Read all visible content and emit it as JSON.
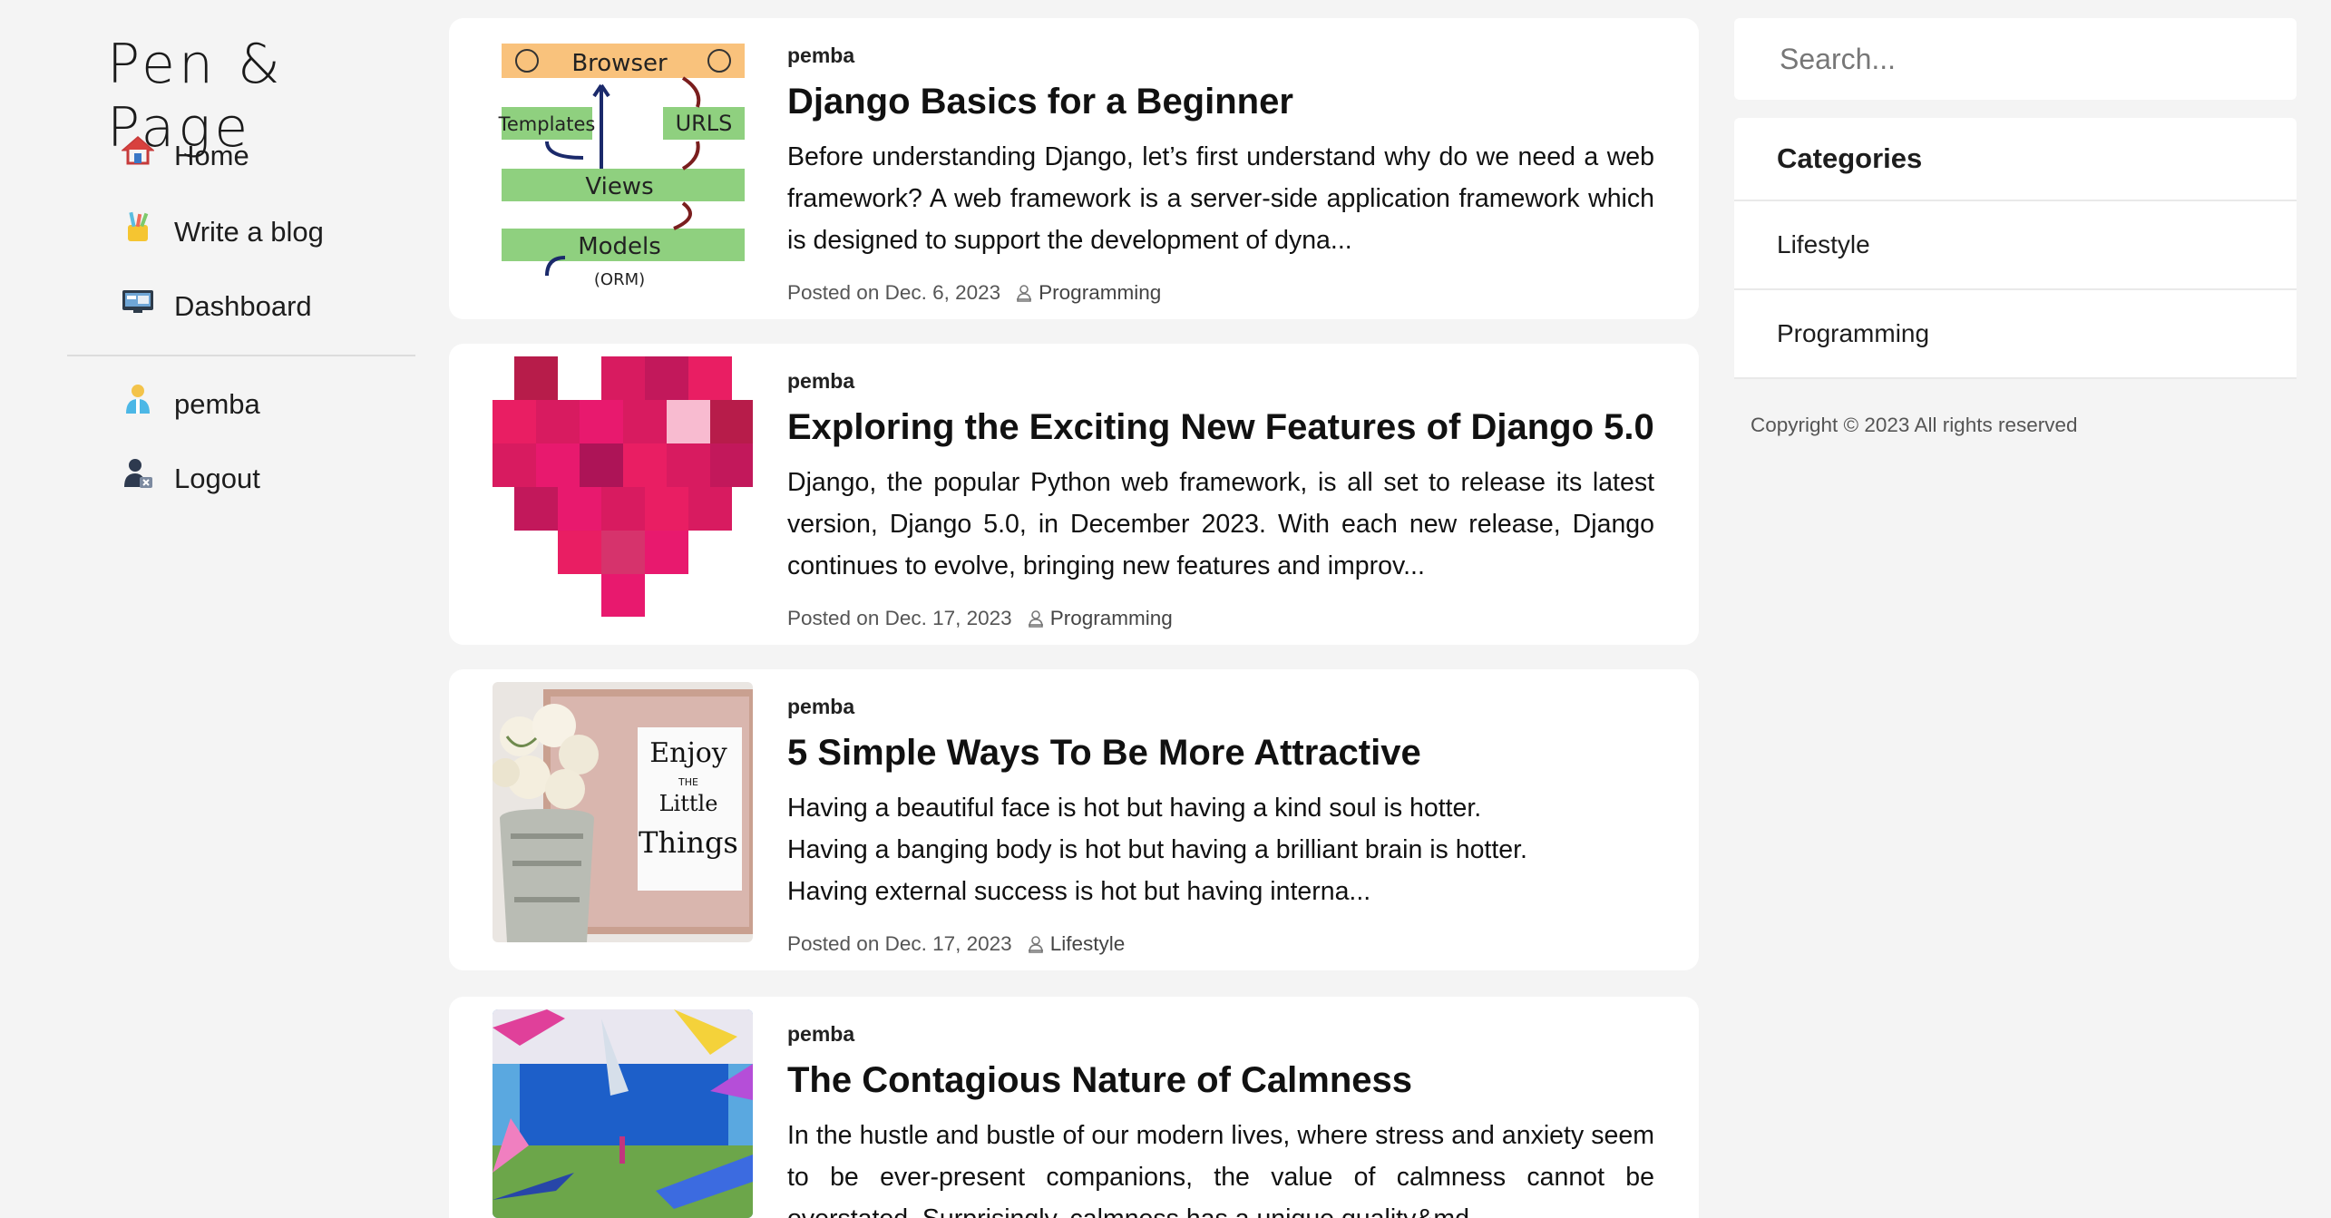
{
  "brand": {
    "logo_text": "Pen & Page"
  },
  "sidebar": {
    "items": [
      {
        "label": "Home",
        "icon": "home-icon"
      },
      {
        "label": "Write a blog",
        "icon": "pencil-cup-icon"
      },
      {
        "label": "Dashboard",
        "icon": "monitor-icon"
      }
    ],
    "user_items": [
      {
        "label": "pemba",
        "icon": "user-icon"
      },
      {
        "label": "Logout",
        "icon": "logout-icon"
      }
    ]
  },
  "posts": [
    {
      "author": "pemba",
      "title": "Django Basics for a Beginner",
      "excerpt": "Before understanding Django, let’s first understand why do we need a web framework? A web framework is a server-side application framework which is designed to support the development of dyna...",
      "posted": "Posted on Dec. 6, 2023",
      "category": "Programming",
      "thumb_labels": [
        "Browser",
        "Templates",
        "URLS",
        "Views",
        "Models",
        "(ORM)"
      ]
    },
    {
      "author": "pemba",
      "title": "Exploring the Exciting New Features of Django 5.0",
      "excerpt": "Django, the popular Python web framework, is all set to release its latest version, Django 5.0, in December 2023. With each new release, Django continues to evolve, bringing new features and improv...",
      "posted": "Posted on Dec. 17, 2023",
      "category": "Programming"
    },
    {
      "author": "pemba",
      "title": "5 Simple Ways To Be More Attractive",
      "excerpt_lines": [
        "Having a beautiful face is hot but having a kind soul is hotter.",
        "Having a banging body is hot but having a brilliant brain is hotter.",
        "Having external success is hot but having interna..."
      ],
      "posted": "Posted on Dec. 17, 2023",
      "category": "Lifestyle",
      "thumb_labels": [
        "Enjoy",
        "THE",
        "Little",
        "Things"
      ]
    },
    {
      "author": "pemba",
      "title": "The Contagious Nature of Calmness",
      "excerpt": "In the hustle and bustle of our modern lives, where stress and anxiety seem to be ever-present companions, the value of calmness cannot be overstated. Surprisingly, calmness has a unique quality&md..."
    }
  ],
  "search": {
    "placeholder": "Search..."
  },
  "categories": {
    "heading": "Categories",
    "items": [
      "Lifestyle",
      "Programming"
    ]
  },
  "footer": {
    "copyright": "Copyright © 2023 All rights reserved"
  },
  "colors": {
    "background": "#f4f4f4",
    "card": "#ffffff",
    "heart": "#e8196e"
  }
}
